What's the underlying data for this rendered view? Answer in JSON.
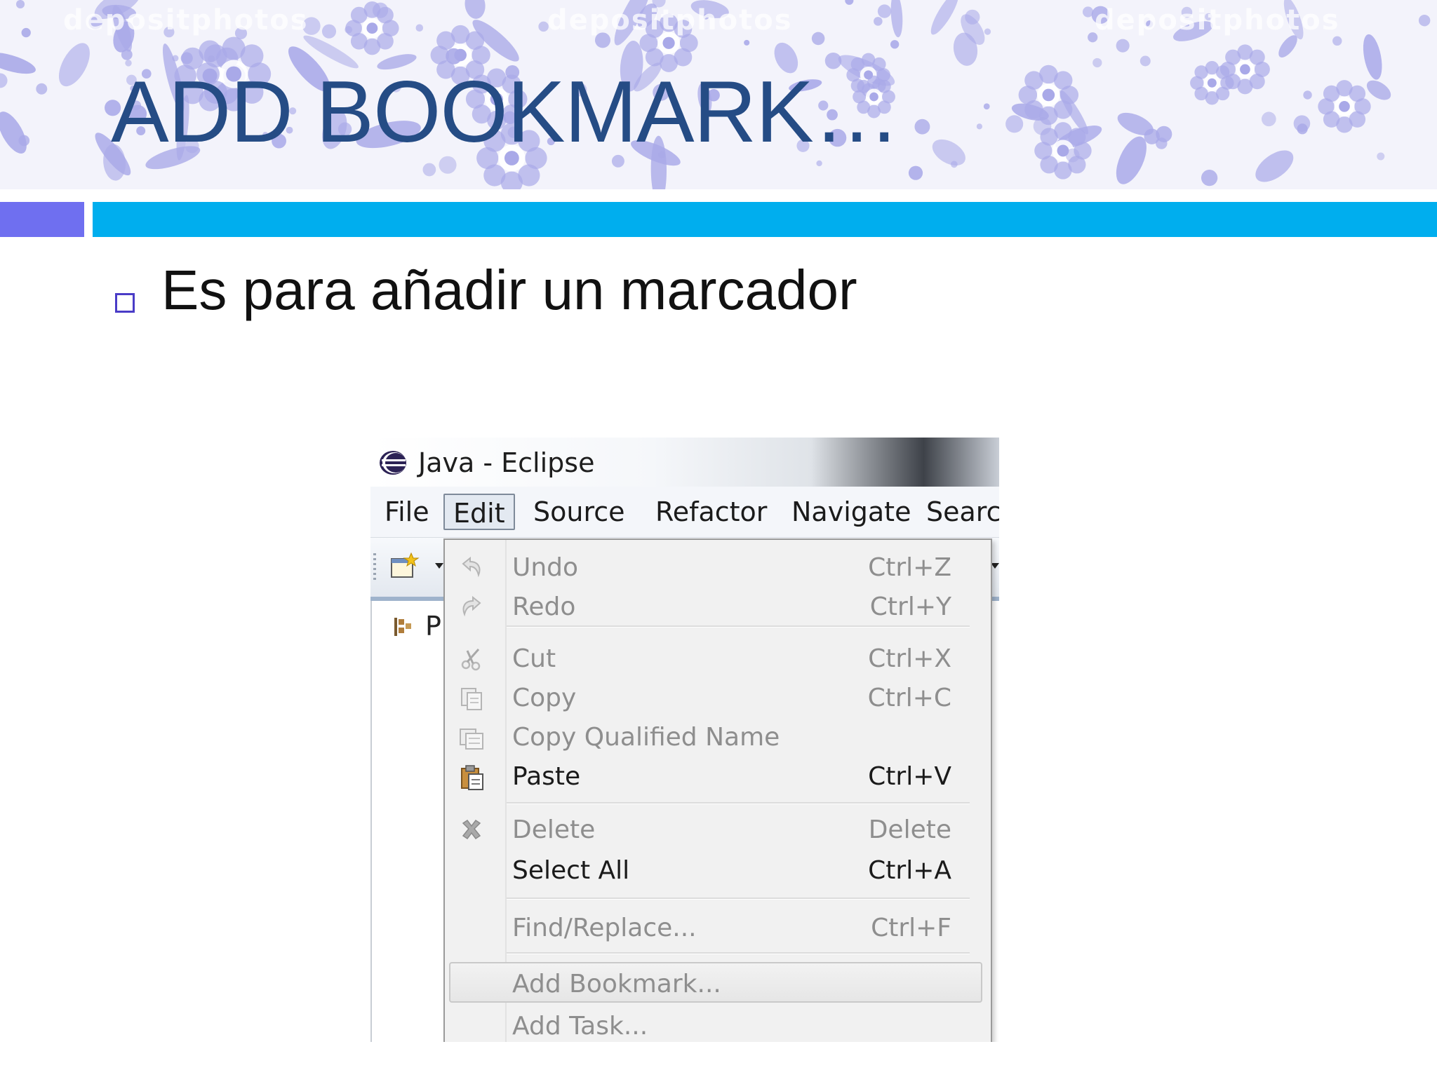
{
  "slide": {
    "title": "ADD BOOKMARK…",
    "bullet": "Es para añadir un marcador",
    "watermarks": [
      "depositphotos",
      "depositphotos",
      "depositphotos"
    ],
    "colors": {
      "title": "#254c85",
      "accent_left": "#6f6ff0",
      "accent_right": "#00aeee",
      "bullet": "#4a3cc7",
      "floral": "#a9a9e8"
    }
  },
  "eclipse": {
    "window_title": "Java - Eclipse",
    "menus": [
      {
        "label": "File"
      },
      {
        "label": "Edit"
      },
      {
        "label": "Source"
      },
      {
        "label": "Refactor"
      },
      {
        "label": "Navigate"
      },
      {
        "label": "Search"
      }
    ],
    "active_menu": "Edit",
    "package_panel_label": "P",
    "edit_menu": {
      "items": [
        {
          "label": "Undo",
          "shortcut": "Ctrl+Z",
          "icon": "undo-icon",
          "enabled": false
        },
        {
          "label": "Redo",
          "shortcut": "Ctrl+Y",
          "icon": "redo-icon",
          "enabled": false
        },
        {
          "label": "Cut",
          "shortcut": "Ctrl+X",
          "icon": "scissors-icon",
          "enabled": false
        },
        {
          "label": "Copy",
          "shortcut": "Ctrl+C",
          "icon": "copy-icon",
          "enabled": false
        },
        {
          "label": "Copy Qualified Name",
          "shortcut": "",
          "icon": "copy-qualified-icon",
          "enabled": false
        },
        {
          "label": "Paste",
          "shortcut": "Ctrl+V",
          "icon": "clipboard-icon",
          "enabled": true
        },
        {
          "label": "Delete",
          "shortcut": "Delete",
          "icon": "delete-x-icon",
          "enabled": false
        },
        {
          "label": "Select All",
          "shortcut": "Ctrl+A",
          "icon": "",
          "enabled": true
        },
        {
          "label": "Find/Replace...",
          "shortcut": "Ctrl+F",
          "icon": "",
          "enabled": false
        },
        {
          "label": "Add Bookmark...",
          "shortcut": "",
          "icon": "",
          "enabled": false,
          "highlighted": true
        },
        {
          "label": "Add Task...",
          "shortcut": "",
          "icon": "",
          "enabled": false
        }
      ]
    }
  }
}
